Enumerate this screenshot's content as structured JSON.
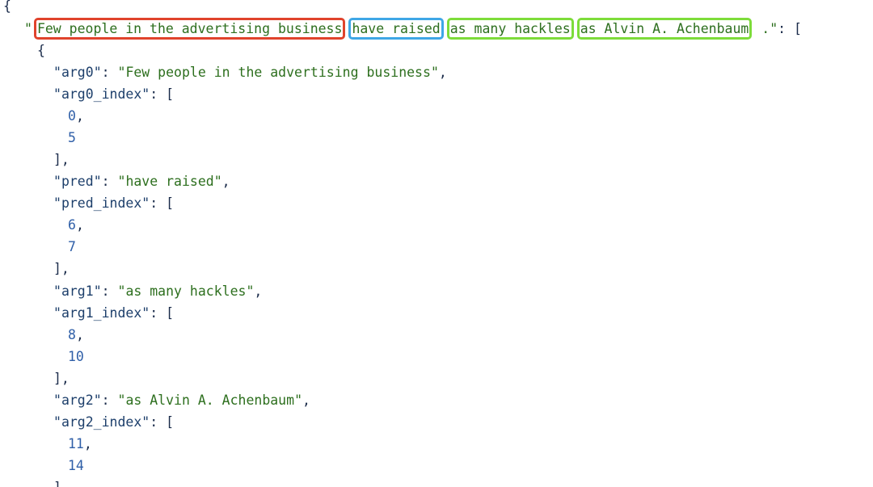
{
  "sentence": {
    "arg0": "Few people in the advertising business",
    "pred": "have raised",
    "arg1": "as many hackles",
    "arg2": "as Alvin A. Achenbaum",
    "tail": " ."
  },
  "entry": {
    "arg0_key": "arg0",
    "arg0_value": "Few people in the advertising business",
    "arg0_index_key": "arg0_index",
    "arg0_index": [
      "0",
      "5"
    ],
    "pred_key": "pred",
    "pred_value": "have raised",
    "pred_index_key": "pred_index",
    "pred_index": [
      "6",
      "7"
    ],
    "arg1_key": "arg1",
    "arg1_value": "as many hackles",
    "arg1_index_key": "arg1_index",
    "arg1_index": [
      "8",
      "10"
    ],
    "arg2_key": "arg2",
    "arg2_value": "as Alvin A. Achenbaum",
    "arg2_index_key": "arg2_index",
    "arg2_index": [
      "11",
      "14"
    ]
  },
  "colors": {
    "arg0_box": "#e0432c",
    "pred_box": "#3fa7e6",
    "arg_box": "#7ddc3a",
    "string": "#2d6f1e",
    "number": "#2f5fa8"
  }
}
